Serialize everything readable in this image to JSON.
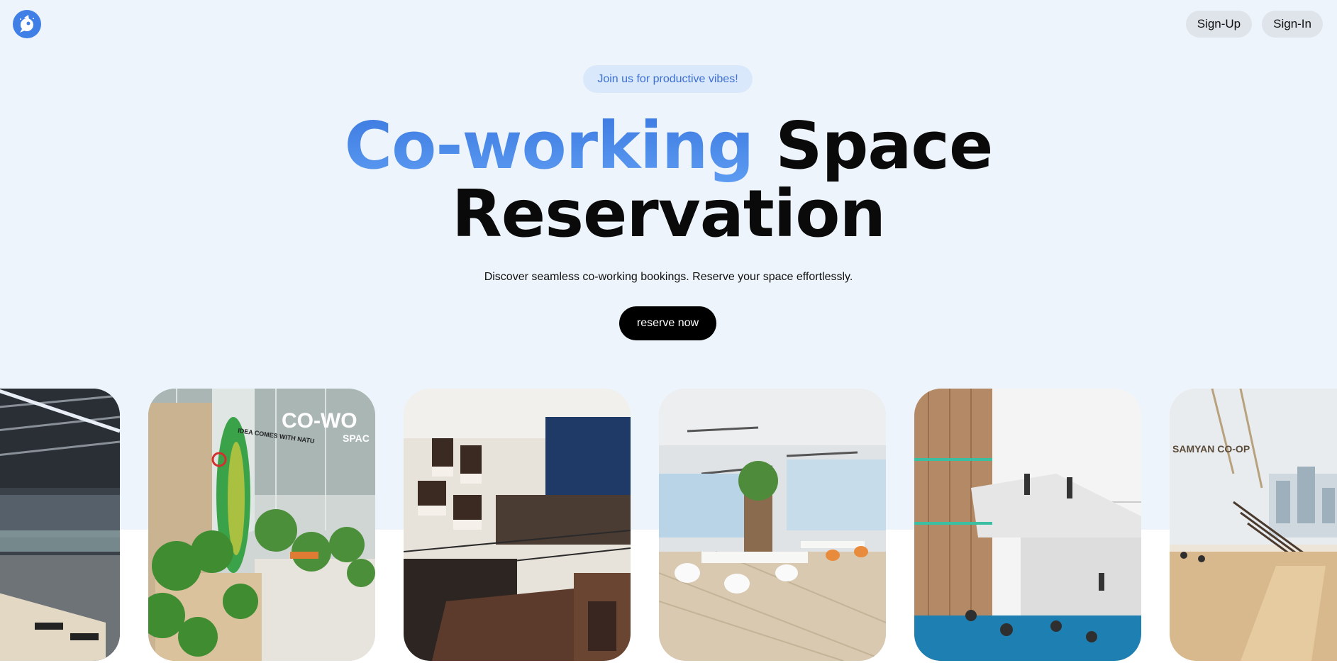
{
  "header": {
    "logo_icon": "rocket-mascot-icon",
    "nav": [
      {
        "label": "Sign-Up"
      },
      {
        "label": "Sign-In"
      }
    ]
  },
  "hero": {
    "tagline": "Join us for productive vibes!",
    "title_accent": "Co-working",
    "title_rest_line1": "Space",
    "title_line2": "Reservation",
    "subtitle": "Discover seamless co-working bookings. Reserve your space effortlessly.",
    "cta_label": "reserve now"
  },
  "gallery": {
    "images": [
      {
        "name": "photo-industrial-hall"
      },
      {
        "name": "photo-co-working-space-plants",
        "sign": "CO-WO",
        "sign_sub": "SPAC",
        "mural": "IDEA COMES WITH NATU"
      },
      {
        "name": "photo-cafe-mezzanine"
      },
      {
        "name": "photo-open-office-desks"
      },
      {
        "name": "photo-atrium-stairs"
      },
      {
        "name": "photo-samyan-co-op",
        "sign": "SAMYAN CO-OP"
      }
    ]
  },
  "colors": {
    "background": "#eef4fb",
    "accent": "#3f7fe6",
    "pill_bg": "#d9e8fb",
    "cta_bg": "#000000"
  }
}
